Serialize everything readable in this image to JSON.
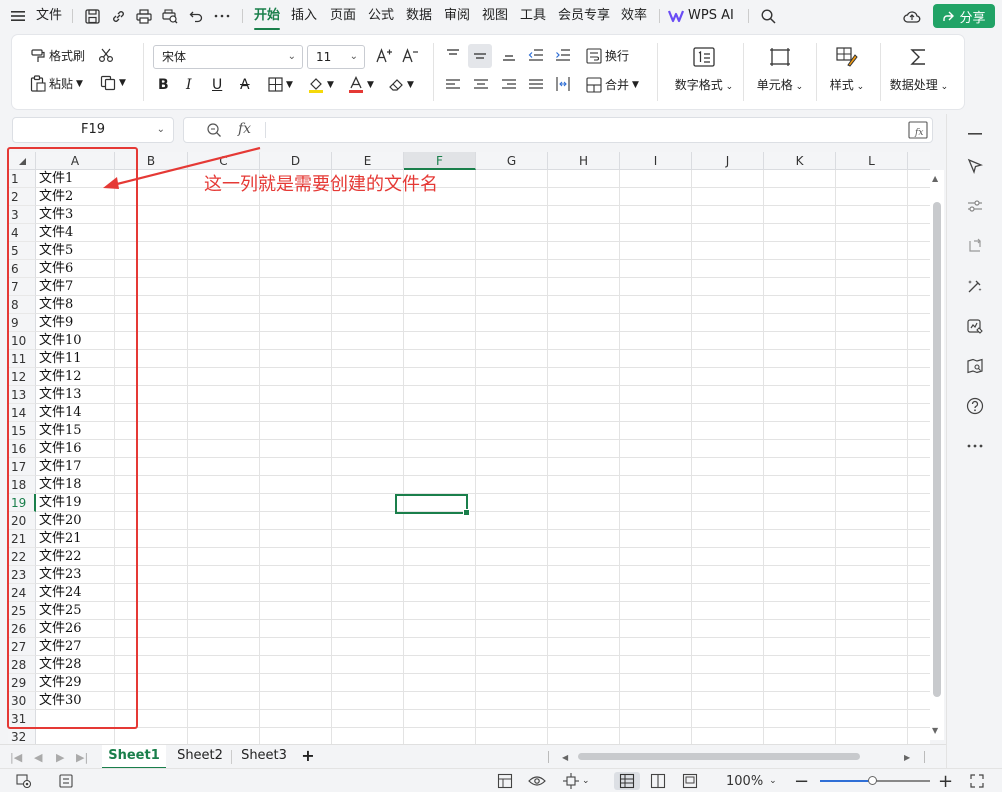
{
  "menubar": {
    "file_label": "文件",
    "tabs": [
      "开始",
      "插入",
      "页面",
      "公式",
      "数据",
      "审阅",
      "视图",
      "工具",
      "会员专享",
      "效率"
    ],
    "wps_ai_label": "WPS AI",
    "share_label": "分享"
  },
  "ribbon": {
    "format_painter": "格式刷",
    "paste": "粘贴",
    "font_name": "宋体",
    "font_size": "11",
    "wrap": "换行",
    "merge": "合并",
    "number_format": "数字格式",
    "cell": "单元格",
    "style": "样式",
    "data_processing": "数据处理"
  },
  "formula_bar": {
    "name_box": "F19",
    "fx": "fx",
    "content": ""
  },
  "grid": {
    "columns": [
      "A",
      "B",
      "C",
      "D",
      "E",
      "F",
      "G",
      "H",
      "I",
      "J",
      "K",
      "L"
    ],
    "selected_column": "F",
    "selected_row": 19,
    "rows": [
      "1",
      "2",
      "3",
      "4",
      "5",
      "6",
      "7",
      "8",
      "9",
      "10",
      "11",
      "12",
      "13",
      "14",
      "15",
      "16",
      "17",
      "18",
      "19",
      "20",
      "21",
      "22",
      "23",
      "24",
      "25",
      "26",
      "27",
      "28",
      "29",
      "30",
      "31",
      "32"
    ],
    "column_a_values": [
      "文件1",
      "文件2",
      "文件3",
      "文件4",
      "文件5",
      "文件6",
      "文件7",
      "文件8",
      "文件9",
      "文件10",
      "文件11",
      "文件12",
      "文件13",
      "文件14",
      "文件15",
      "文件16",
      "文件17",
      "文件18",
      "文件19",
      "文件20",
      "文件21",
      "文件22",
      "文件23",
      "文件24",
      "文件25",
      "文件26",
      "文件27",
      "文件28",
      "文件29",
      "文件30"
    ]
  },
  "annotation": {
    "text": "这一列就是需要创建的文件名",
    "color": "#e53935"
  },
  "sheet_tabs": {
    "tabs": [
      "Sheet1",
      "Sheet2",
      "Sheet3"
    ],
    "active": "Sheet1",
    "add_label": "+"
  },
  "status_bar": {
    "zoom": "100%"
  },
  "colors": {
    "accent": "#1a7f4b",
    "share_button": "#21a366",
    "annotation": "#e53935"
  }
}
